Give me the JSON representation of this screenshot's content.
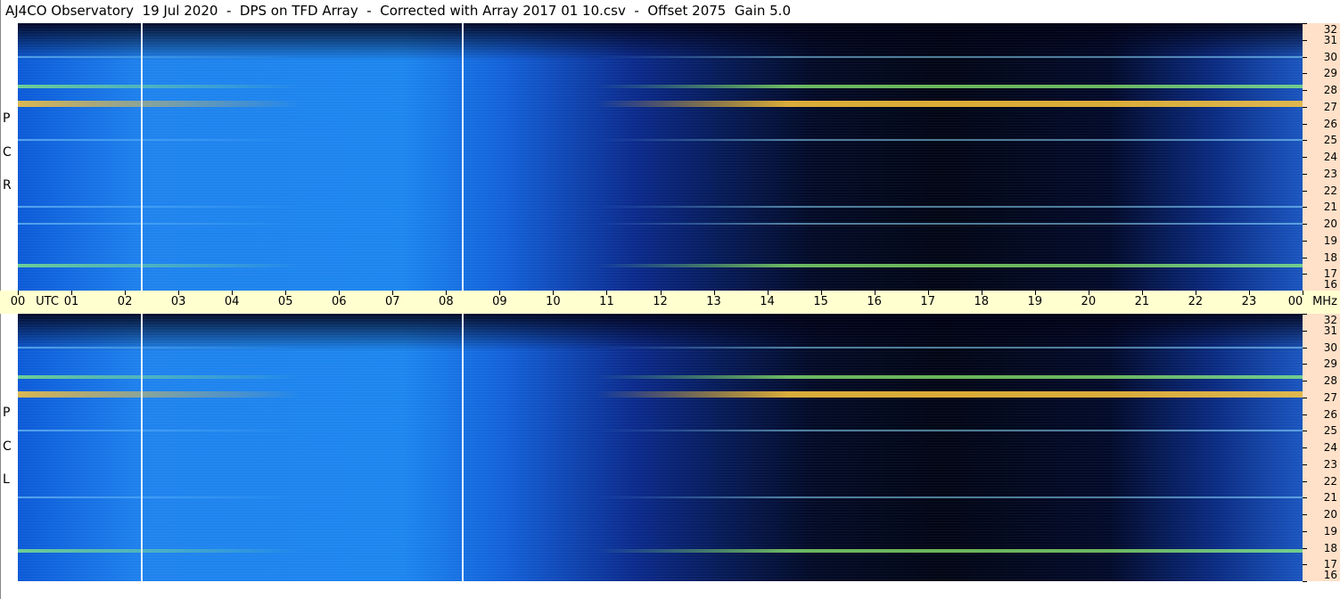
{
  "title": "AJ4CO Observatory  19 Jul 2020  -  DPS on TFD Array  -  Corrected with Array 2017 01 10.csv  -  Offset 2075  Gain 5.0",
  "top_panel": {
    "polarization_letters": [
      "R",
      "C",
      "P"
    ]
  },
  "bottom_panel": {
    "polarization_letters": [
      "L",
      "C",
      "P"
    ]
  },
  "colors": {
    "time_bar": "#ffffd0",
    "freq_axis": "#ffe0c8",
    "marker_line": "#e8f4ff"
  },
  "chart_data": [
    {
      "type": "heatmap",
      "panel": "RCP",
      "x_axis": {
        "label_left": "00",
        "unit_label": "UTC",
        "tick_labels": [
          "00",
          "01",
          "02",
          "03",
          "04",
          "05",
          "06",
          "07",
          "08",
          "09",
          "10",
          "11",
          "12",
          "13",
          "14",
          "15",
          "16",
          "17",
          "18",
          "19",
          "20",
          "21",
          "22",
          "23",
          "00"
        ],
        "range_hours": [
          0,
          24
        ]
      },
      "y_axis": {
        "unit_label": "MHz",
        "tick_labels": [
          "32",
          "31",
          "30",
          "29",
          "28",
          "27",
          "26",
          "25",
          "24",
          "23",
          "22",
          "21",
          "20",
          "19",
          "18",
          "17",
          "16"
        ],
        "range_mhz": [
          16,
          32
        ]
      },
      "markers_utc_hours": [
        2.3,
        8.3
      ],
      "features": [
        {
          "kind": "interference band",
          "freq_mhz": 27.2,
          "strength": "strong"
        },
        {
          "kind": "interference band",
          "freq_mhz": 28.2,
          "strength": "moderate"
        },
        {
          "kind": "interference band",
          "freq_mhz": 17.5,
          "strength": "moderate"
        },
        {
          "kind": "interference band",
          "freq_mhz": 21.0,
          "strength": "weak"
        },
        {
          "kind": "interference band",
          "freq_mhz": 20.0,
          "strength": "weak"
        },
        {
          "kind": "interference band",
          "freq_mhz": 25.0,
          "strength": "weak"
        },
        {
          "kind": "interference band",
          "freq_mhz": 30.0,
          "strength": "weak"
        }
      ]
    },
    {
      "type": "heatmap",
      "panel": "LCP",
      "x_axis": {
        "tick_labels": [
          "00",
          "01",
          "02",
          "03",
          "04",
          "05",
          "06",
          "07",
          "08",
          "09",
          "10",
          "11",
          "12",
          "13",
          "14",
          "15",
          "16",
          "17",
          "18",
          "19",
          "20",
          "21",
          "22",
          "23",
          "00"
        ],
        "range_hours": [
          0,
          24
        ]
      },
      "y_axis": {
        "unit_label": "MHz",
        "tick_labels": [
          "32",
          "31",
          "30",
          "29",
          "28",
          "27",
          "26",
          "25",
          "24",
          "23",
          "22",
          "21",
          "20",
          "19",
          "18",
          "17",
          "16"
        ],
        "range_mhz": [
          16,
          32
        ]
      },
      "markers_utc_hours": [
        2.3,
        8.3
      ],
      "features": [
        {
          "kind": "interference band",
          "freq_mhz": 27.2,
          "strength": "strong"
        },
        {
          "kind": "interference band",
          "freq_mhz": 28.2,
          "strength": "moderate"
        },
        {
          "kind": "interference band",
          "freq_mhz": 17.8,
          "strength": "moderate"
        },
        {
          "kind": "interference band",
          "freq_mhz": 21.0,
          "strength": "weak"
        },
        {
          "kind": "interference band",
          "freq_mhz": 25.0,
          "strength": "weak"
        },
        {
          "kind": "interference band",
          "freq_mhz": 30.0,
          "strength": "weak"
        }
      ]
    }
  ]
}
